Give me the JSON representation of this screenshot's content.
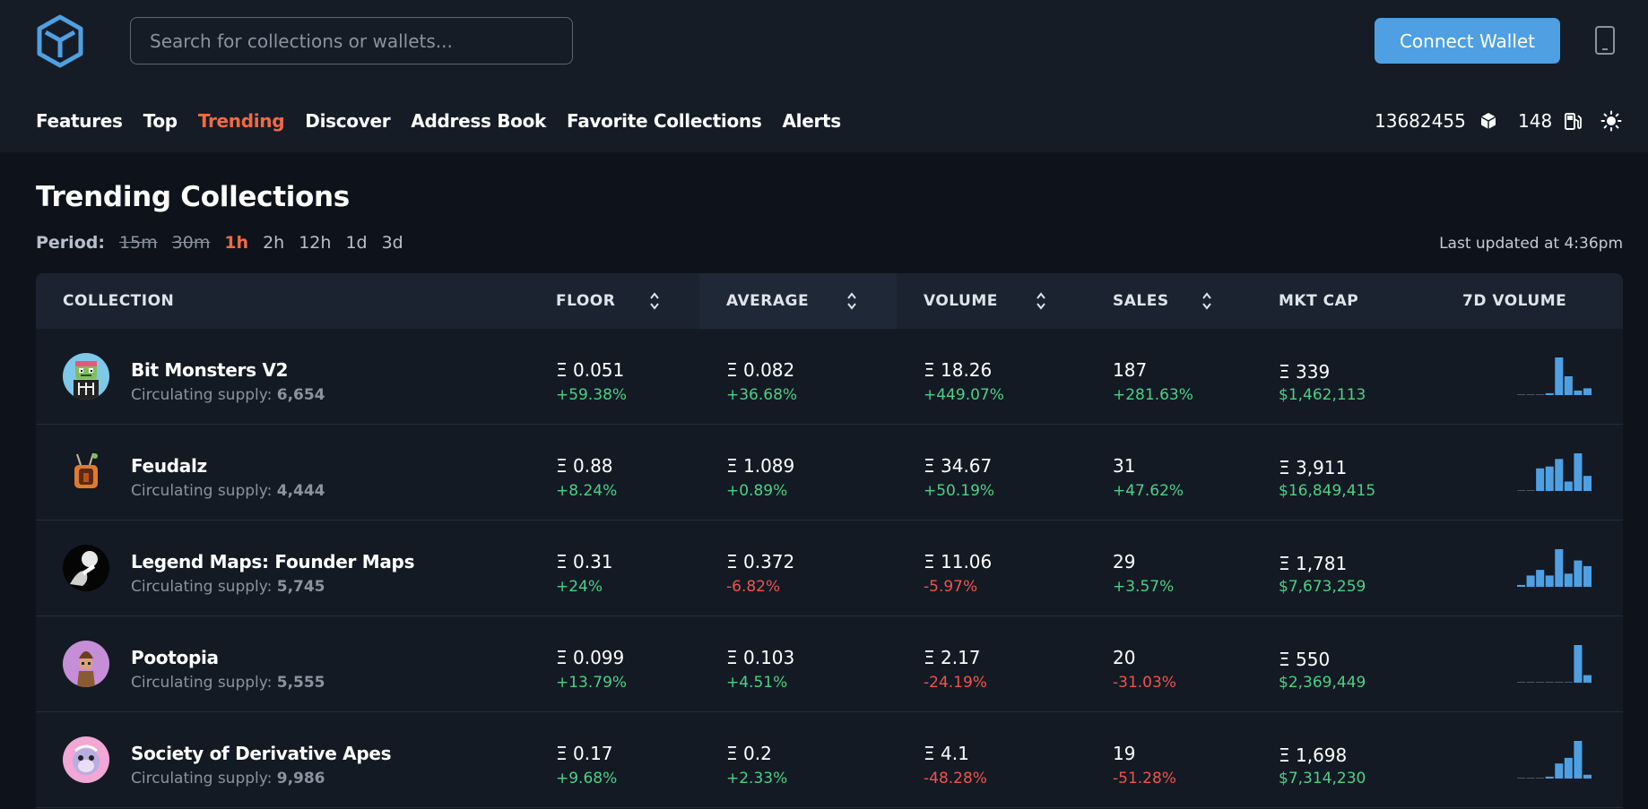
{
  "header": {
    "search_placeholder": "Search for collections or wallets...",
    "connect_label": "Connect Wallet",
    "logo_icon": "cube-logo-icon",
    "mobile_icon": "mobile-phone-icon"
  },
  "nav": {
    "items": [
      "Features",
      "Top",
      "Trending",
      "Discover",
      "Address Book",
      "Favorite Collections",
      "Alerts"
    ],
    "active": "Trending",
    "block_number": "13682455",
    "gas_price": "148",
    "theme_icon": "sun-icon"
  },
  "page": {
    "title": "Trending Collections",
    "period_label": "Period:",
    "periods": [
      "15m",
      "30m",
      "1h",
      "2h",
      "12h",
      "1d",
      "3d"
    ],
    "disabled_periods": [
      "15m",
      "30m"
    ],
    "active_period": "1h",
    "updated": "Last updated at 4:36pm"
  },
  "table": {
    "headers": {
      "collection": "COLLECTION",
      "floor": "FLOOR",
      "average": "AVERAGE",
      "volume": "VOLUME",
      "sales": "SALES",
      "mkt_cap": "MKT CAP",
      "volume_7d": "7D VOLUME"
    },
    "supply_label": "Circulating supply:",
    "rows": [
      {
        "name": "Bit Monsters V2",
        "supply": "6,654",
        "floor": "Ξ 0.051",
        "floor_chg": "+59.38%",
        "average": "Ξ 0.082",
        "average_chg": "+36.68%",
        "volume": "Ξ 18.26",
        "volume_chg": "+449.07%",
        "sales": "187",
        "sales_chg": "+281.63%",
        "mkt_cap": "Ξ 339",
        "mkt_cap_usd": "$1,462,113",
        "spark": [
          0,
          0,
          0,
          0.05,
          1,
          0.5,
          0.12,
          0.18
        ]
      },
      {
        "name": "Feudalz",
        "supply": "4,444",
        "floor": "Ξ 0.88",
        "floor_chg": "+8.24%",
        "average": "Ξ 1.089",
        "average_chg": "+0.89%",
        "volume": "Ξ 34.67",
        "volume_chg": "+50.19%",
        "sales": "31",
        "sales_chg": "+47.62%",
        "mkt_cap": "Ξ 3,911",
        "mkt_cap_usd": "$16,849,415",
        "spark": [
          0,
          0,
          0.6,
          0.65,
          0.85,
          0.25,
          1,
          0.4
        ]
      },
      {
        "name": "Legend Maps: Founder Maps",
        "supply": "5,745",
        "floor": "Ξ 0.31",
        "floor_chg": "+24%",
        "average": "Ξ 0.372",
        "average_chg": "-6.82%",
        "volume": "Ξ 11.06",
        "volume_chg": "-5.97%",
        "sales": "29",
        "sales_chg": "+3.57%",
        "mkt_cap": "Ξ 1,781",
        "mkt_cap_usd": "$7,673,259",
        "spark": [
          0.05,
          0.3,
          0.45,
          0.3,
          1,
          0.35,
          0.7,
          0.55
        ]
      },
      {
        "name": "Pootopia",
        "supply": "5,555",
        "floor": "Ξ 0.099",
        "floor_chg": "+13.79%",
        "average": "Ξ 0.103",
        "average_chg": "+4.51%",
        "volume": "Ξ 2.17",
        "volume_chg": "-24.19%",
        "sales": "20",
        "sales_chg": "-31.03%",
        "mkt_cap": "Ξ 550",
        "mkt_cap_usd": "$2,369,449",
        "spark": [
          0,
          0,
          0,
          0,
          0,
          0,
          1,
          0.2
        ]
      },
      {
        "name": "Society of Derivative Apes",
        "supply": "9,986",
        "floor": "Ξ 0.17",
        "floor_chg": "+9.68%",
        "average": "Ξ 0.2",
        "average_chg": "+2.33%",
        "volume": "Ξ 4.1",
        "volume_chg": "-48.28%",
        "sales": "19",
        "sales_chg": "-51.28%",
        "mkt_cap": "Ξ 1,698",
        "mkt_cap_usd": "$7,314,230",
        "spark": [
          0,
          0,
          0,
          0.05,
          0.4,
          0.55,
          1,
          0.1
        ]
      }
    ]
  },
  "colors": {
    "accent": "#f06a45",
    "primary_button": "#4ea0e2",
    "positive": "#4fcf87",
    "negative": "#ef5350",
    "spark_bar": "#4ea0e2"
  }
}
